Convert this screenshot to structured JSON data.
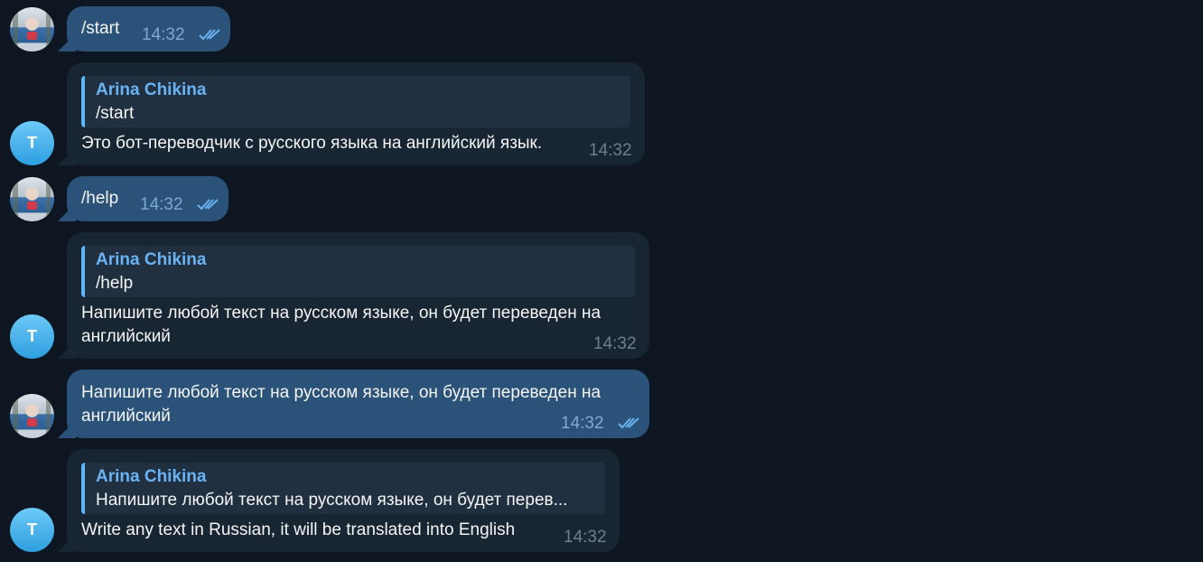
{
  "messages": [
    {
      "text": "/start",
      "time": "14:32",
      "status": "read"
    },
    {
      "reply_name": "Arina Chikina",
      "reply_text": "/start",
      "text": "Это бот-переводчик с русского языка на английский язык.",
      "time": "14:32",
      "avatar_letter": "T"
    },
    {
      "text": "/help",
      "time": "14:32",
      "status": "read"
    },
    {
      "reply_name": "Arina Chikina",
      "reply_text": "/help",
      "text_line1": "Напишите любой текст на русском языке, он будет переведен на",
      "text_line2": "английский",
      "time": "14:32",
      "avatar_letter": "T"
    },
    {
      "text_line1": "Напишите любой текст на русском языке, он будет переведен на",
      "text_line2": "английский",
      "time": "14:32",
      "status": "read"
    },
    {
      "reply_name": "Arina Chikina",
      "reply_text": "Напишите любой текст на русском языке, он будет перев...",
      "text": "Write any text in Russian, it will be translated into English",
      "time": "14:32",
      "avatar_letter": "T"
    }
  ],
  "colors": {
    "background": "#0e1621",
    "outgoing": "#2b5278",
    "incoming": "#182533",
    "accent": "#6ab3f3"
  },
  "icons": {
    "read_status": "double-check-icon"
  }
}
